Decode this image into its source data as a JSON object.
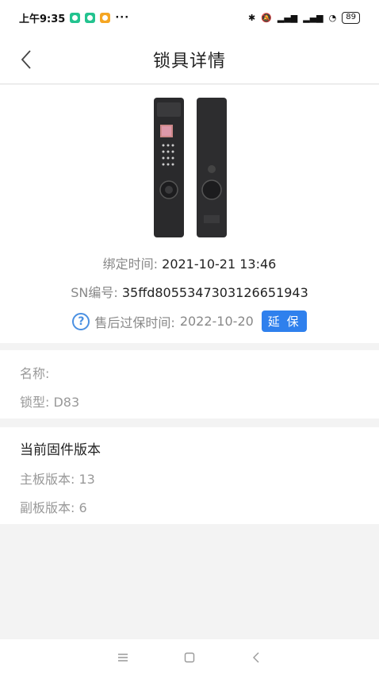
{
  "status_bar": {
    "time": "上午9:35",
    "icons": [
      "bluetooth-icon",
      "mute-icon",
      "signal-icon",
      "signal-icon",
      "wifi-icon"
    ],
    "battery": "89",
    "colors": {
      "badge1": "#23c38f",
      "badge2": "#23c38f",
      "badge3": "#f5a623"
    }
  },
  "header": {
    "title": "锁具详情"
  },
  "device": {
    "bind_label": "绑定时间: ",
    "bind_time": "2021-10-21 13:46",
    "sn_label": "SN编号: ",
    "sn": "35ffd8055347303126651943",
    "warranty_label": "售后过保时间:",
    "warranty_date": "2022-10-20",
    "extend_label": "延 保"
  },
  "details": {
    "name_label": "名称:",
    "type_label": "锁型: ",
    "type_value": "D83"
  },
  "firmware": {
    "title": "当前固件版本",
    "main_label": "主板版本: ",
    "main_version": "13",
    "sub_label": "副板版本: ",
    "sub_version": "6"
  },
  "accent_color": "#2f80ed"
}
